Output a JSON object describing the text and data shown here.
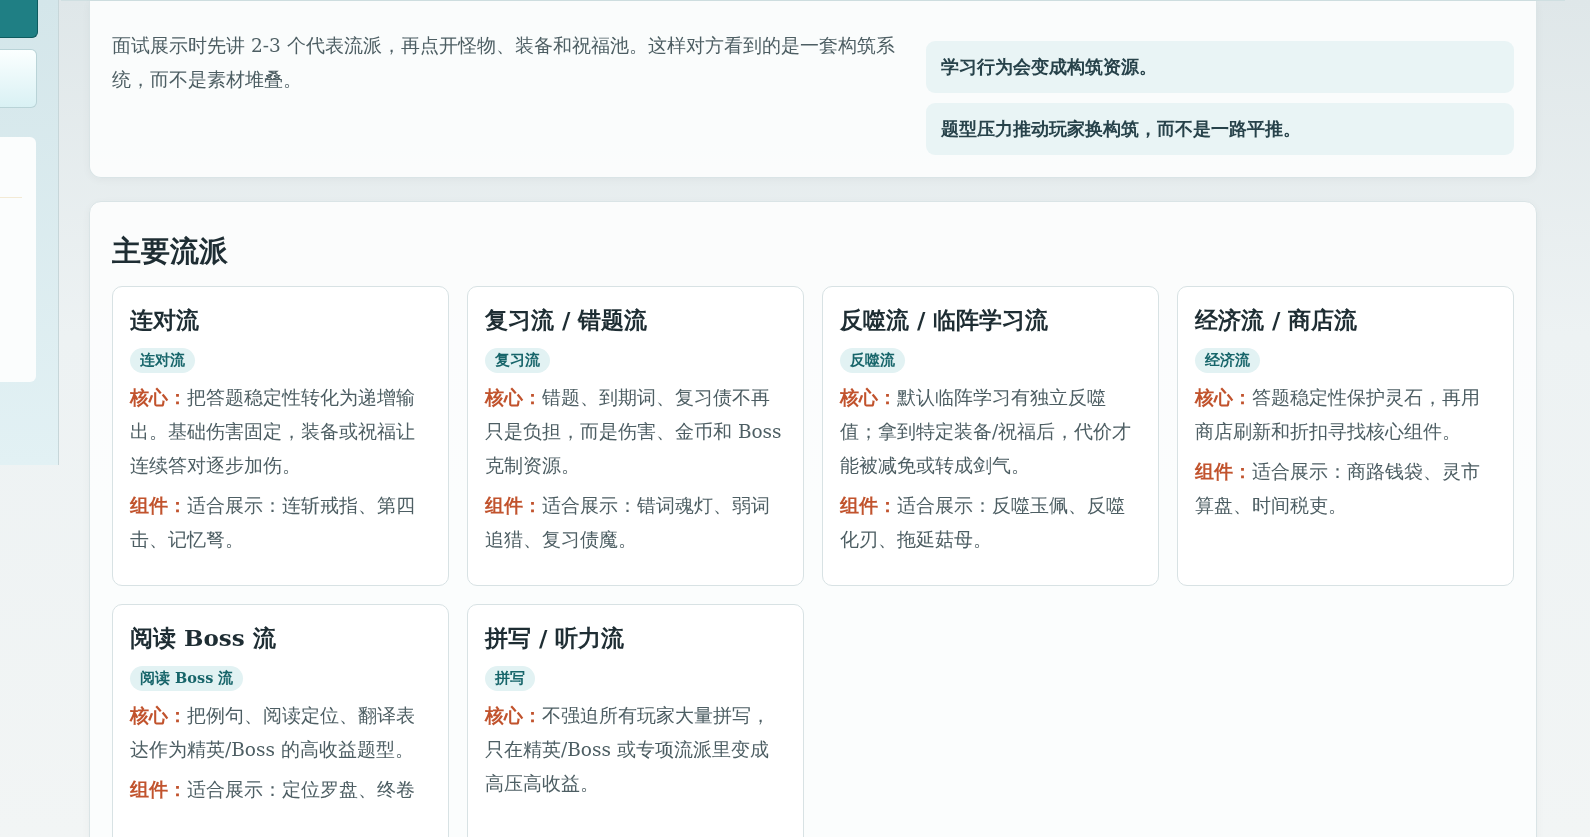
{
  "sidebar": {
    "cards": [
      {
        "kind": "button"
      },
      {
        "kind": "plain"
      },
      {
        "kind": "note"
      }
    ]
  },
  "intro": {
    "text": "面试展示时先讲 2-3 个代表流派，再点开怪物、装备和祝福池。这样对方看到的是一套构筑系统，而不是素材堆叠。",
    "points": [
      "学习行为会变成构筑资源。",
      "题型压力推动玩家换构筑，而不是一路平推。"
    ]
  },
  "schools": {
    "title": "主要流派",
    "cards": [
      {
        "title": "连对流",
        "tag": "连对流",
        "core_label": "核心：",
        "core": "把答题稳定性转化为递增输出。基础伤害固定，装备或祝福让连续答对逐步加伤。",
        "parts_label": "组件：",
        "parts": "适合展示：连斩戒指、第四击、记忆弩。"
      },
      {
        "title": "复习流 / 错题流",
        "tag": "复习流",
        "core_label": "核心：",
        "core": "错题、到期词、复习债不再只是负担，而是伤害、金币和 Boss 克制资源。",
        "parts_label": "组件：",
        "parts": "适合展示：错词魂灯、弱词追猎、复习债魔。"
      },
      {
        "title": "反噬流 / 临阵学习流",
        "tag": "反噬流",
        "core_label": "核心：",
        "core": "默认临阵学习有独立反噬值；拿到特定装备/祝福后，代价才能被减免或转成剑气。",
        "parts_label": "组件：",
        "parts": "适合展示：反噬玉佩、反噬化刃、拖延菇母。"
      },
      {
        "title": "经济流 / 商店流",
        "tag": "经济流",
        "core_label": "核心：",
        "core": "答题稳定性保护灵石，再用商店刷新和折扣寻找核心组件。",
        "parts_label": "组件：",
        "parts": "适合展示：商路钱袋、灵市算盘、时间税吏。"
      },
      {
        "title": "阅读 Boss 流",
        "tag": "阅读 Boss 流",
        "core_label": "核心：",
        "core": "把例句、阅读定位、翻译表达作为精英/Boss 的高收益题型。",
        "parts_label": "组件：",
        "parts": "适合展示：定位罗盘、终卷"
      },
      {
        "title": "拼写 / 听力流",
        "tag": "拼写",
        "core_label": "核心：",
        "core": "不强迫所有玩家大量拼写，只在精英/Boss 或专项流派里变成高压高收益。"
      }
    ]
  }
}
